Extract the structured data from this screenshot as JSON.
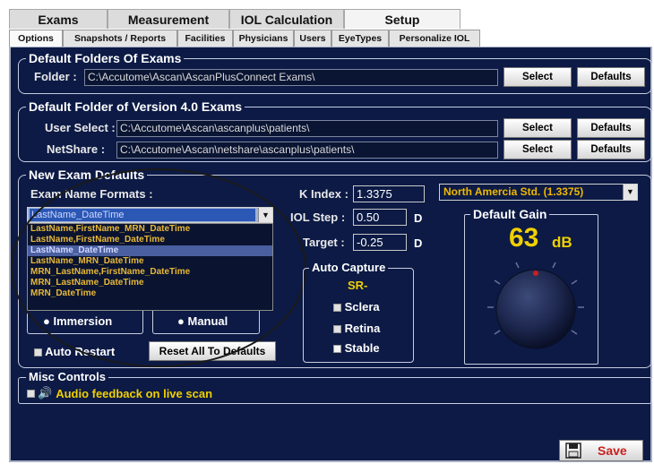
{
  "main_tabs": [
    {
      "label": "Exams",
      "active": false
    },
    {
      "label": "Measurement",
      "active": false
    },
    {
      "label": "IOL Calculation",
      "active": false
    },
    {
      "label": "Setup",
      "active": true
    }
  ],
  "sub_tabs": [
    {
      "label": "Options",
      "active": true
    },
    {
      "label": "Snapshots / Reports",
      "active": false
    },
    {
      "label": "Facilities",
      "active": false
    },
    {
      "label": "Physicians",
      "active": false
    },
    {
      "label": "Users",
      "active": false
    },
    {
      "label": "EyeTypes",
      "active": false
    },
    {
      "label": "Personalize IOL",
      "active": false
    }
  ],
  "default_folders": {
    "title": "Default Folders Of Exams",
    "folder_label": "Folder :",
    "folder_path": "C:\\Accutome\\Ascan\\AscanPlusConnect Exams\\",
    "select_label": "Select",
    "defaults_label": "Defaults"
  },
  "v4_folder": {
    "title": "Default Folder of Version 4.0 Exams",
    "user_select_label": "User Select :",
    "user_select_path": "C:\\Accutome\\Ascan\\ascanplus\\patients\\",
    "netshare_label": "NetShare :",
    "netshare_path": "C:\\Accutome\\Ascan\\netshare\\ascanplus\\patients\\",
    "select_label": "Select",
    "defaults_label": "Defaults"
  },
  "new_exam": {
    "title": "New Exam Defaults",
    "name_formats_label": "Exam Name Formats :",
    "selected_format": "LastName_DateTime",
    "format_options": [
      "LastName,FirstName_MRN_DateTime",
      "LastName,FirstName_DateTime",
      "LastName_DateTime",
      "LastName_MRN_DateTime",
      "MRN_LastName,FirstName_DateTime",
      "MRN_LastName_DateTime",
      "MRN_DateTime"
    ],
    "highlighted_index": 2,
    "immersion_label": "Immersion",
    "manual_label": "Manual",
    "auto_restart_label": "Auto Restart",
    "reset_label": "Reset All To Defaults",
    "k_index_label": "K Index :",
    "k_index_value": "1.3375",
    "iol_step_label": "IOL Step :",
    "iol_step_value": "0.50",
    "target_label": "Target :",
    "target_value": "-0.25",
    "diopter_unit": "D",
    "standard_select": "North Amercia Std. (1.3375)",
    "auto_capture": {
      "title": "Auto Capture",
      "mode": "SR-",
      "sclera_label": "Sclera",
      "sclera_checked": true,
      "retina_label": "Retina",
      "retina_checked": true,
      "stable_label": "Stable",
      "stable_checked": false
    },
    "gain": {
      "title": "Default Gain",
      "value": "63",
      "unit": "dB"
    }
  },
  "misc": {
    "title": "Misc Controls",
    "audio_label": "Audio feedback on live scan",
    "audio_checked": true
  },
  "save_label": "Save",
  "colors": {
    "panel_bg": "#0c1a45",
    "accent_yellow": "#f0d000",
    "text_orange": "#e8b838"
  }
}
